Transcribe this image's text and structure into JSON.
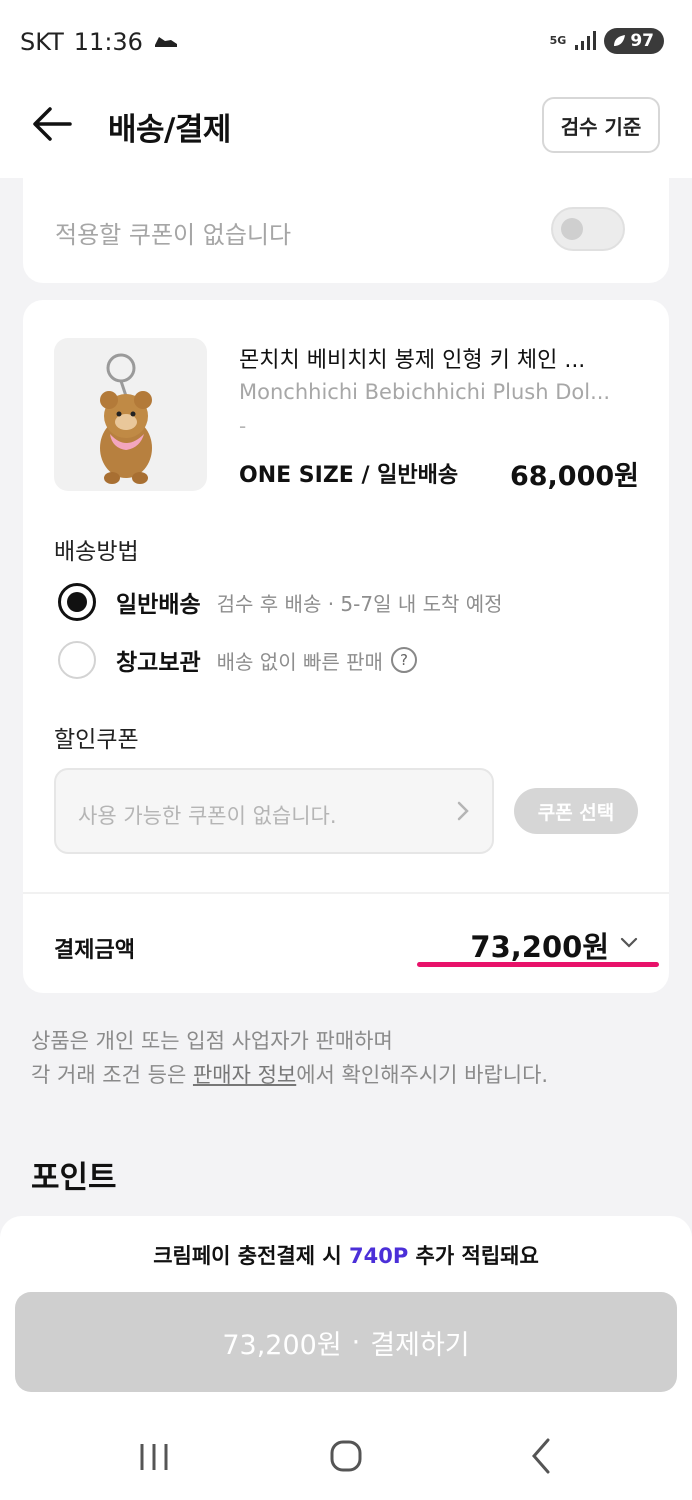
{
  "status_bar": {
    "carrier": "SKT",
    "time": "11:36",
    "network": "5G",
    "battery": "97"
  },
  "header": {
    "title": "배송/결제",
    "criteria_button": "검수 기준"
  },
  "coupon_toggle": {
    "text": "적용할 쿠폰이 없습니다"
  },
  "product": {
    "name": "몬치치 베비치치 봉제 인형 키 체인 ...",
    "name_en": "Monchhichi Bebichhichi Plush Dol...",
    "model_no": "-",
    "option": "ONE SIZE / 일반배송",
    "price": "68,000원"
  },
  "shipping": {
    "label": "배송방법",
    "options": [
      {
        "title": "일반배송",
        "subtitle": "검수 후 배송 · 5-7일 내 도착 예정",
        "selected": true
      },
      {
        "title": "창고보관",
        "subtitle": "배송 없이 빠른 판매",
        "selected": false
      }
    ]
  },
  "discount_coupon": {
    "label": "할인쿠폰",
    "placeholder": "사용 가능한 쿠폰이 없습니다.",
    "button": "쿠폰 선택"
  },
  "total": {
    "label": "결제금액",
    "amount": "73,200원"
  },
  "notice": {
    "line1": "상품은 개인 또는 입점 사업자가 판매하며",
    "line2_prefix": "각 거래 조건 등은 ",
    "line2_link": "판매자 정보",
    "line2_suffix": "에서 확인해주시기 바랍니다."
  },
  "points": {
    "title": "포인트"
  },
  "promo": {
    "prefix": "크림페이 충전결제 시 ",
    "points": "740P",
    "suffix": " 추가 적립돼요"
  },
  "pay_button": {
    "amount": "73,200원",
    "separator": "·",
    "label": "결제하기"
  },
  "colors": {
    "accent_pink": "#e8126a",
    "promo_purple": "#4b2fd8",
    "disabled_button": "#cfcfcf"
  },
  "nav_icons": [
    "recent-apps-icon",
    "home-icon",
    "back-icon"
  ]
}
